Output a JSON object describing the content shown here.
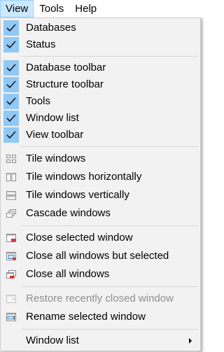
{
  "menubar": {
    "items": [
      {
        "label": "View"
      },
      {
        "label": "Tools"
      },
      {
        "label": "Help"
      }
    ]
  },
  "menu": {
    "items": [
      {
        "label": "Databases",
        "checked": true
      },
      {
        "label": "Status",
        "checked": true
      },
      {
        "label": "Database toolbar",
        "checked": true
      },
      {
        "label": "Structure toolbar",
        "checked": true
      },
      {
        "label": "Tools",
        "checked": true
      },
      {
        "label": "Window list",
        "checked": true
      },
      {
        "label": "View toolbar",
        "checked": true
      },
      {
        "label": "Tile windows",
        "icon": "tile-windows-icon"
      },
      {
        "label": "Tile windows horizontally",
        "icon": "tile-horizontal-icon"
      },
      {
        "label": "Tile windows vertically",
        "icon": "tile-vertical-icon"
      },
      {
        "label": "Cascade windows",
        "icon": "cascade-windows-icon"
      },
      {
        "label": "Close selected window",
        "icon": "close-window-icon"
      },
      {
        "label": "Close all windows but selected",
        "icon": "close-others-icon"
      },
      {
        "label": "Close all windows",
        "icon": "close-all-icon"
      },
      {
        "label": "Restore recently closed window",
        "icon": "restore-window-icon",
        "disabled": true
      },
      {
        "label": "Rename selected window",
        "icon": "rename-window-icon"
      },
      {
        "label": "Window list",
        "submenu": true
      }
    ]
  },
  "colors": {
    "check_bg": "#90c8f6",
    "menubar_active": "#cce8ff",
    "close_red": "#d9363e"
  }
}
